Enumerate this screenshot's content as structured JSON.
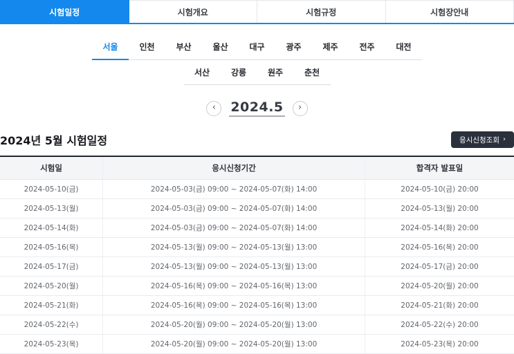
{
  "tabs": [
    {
      "label": "시험일정",
      "active": true
    },
    {
      "label": "시험개요",
      "active": false
    },
    {
      "label": "시험규정",
      "active": false
    },
    {
      "label": "시험장안내",
      "active": false
    }
  ],
  "city_nav": {
    "row1": [
      {
        "label": "서울",
        "active": true
      },
      {
        "label": "인천",
        "active": false
      },
      {
        "label": "부산",
        "active": false
      },
      {
        "label": "울산",
        "active": false
      },
      {
        "label": "대구",
        "active": false
      },
      {
        "label": "광주",
        "active": false
      },
      {
        "label": "제주",
        "active": false
      },
      {
        "label": "전주",
        "active": false
      },
      {
        "label": "대전",
        "active": false
      }
    ],
    "row2": [
      {
        "label": "서산",
        "active": false
      },
      {
        "label": "강릉",
        "active": false
      },
      {
        "label": "원주",
        "active": false
      },
      {
        "label": "춘천",
        "active": false
      }
    ]
  },
  "pager": {
    "prev_icon": "‹",
    "label": "2024.5",
    "next_icon": "›"
  },
  "section": {
    "title": "2024년 5월 시험일정",
    "apply_button_label": "응시신청조회",
    "apply_button_arrow": "›"
  },
  "schedule_table": {
    "headers": [
      "시험일",
      "응시신청기간",
      "합격자 발표일"
    ],
    "rows": [
      [
        "2024-05-10(금)",
        "2024-05-03(금) 09:00 ~ 2024-05-07(화) 14:00",
        "2024-05-10(금) 20:00"
      ],
      [
        "2024-05-13(월)",
        "2024-05-03(금) 09:00 ~ 2024-05-07(화) 14:00",
        "2024-05-13(월) 20:00"
      ],
      [
        "2024-05-14(화)",
        "2024-05-03(금) 09:00 ~ 2024-05-07(화) 14:00",
        "2024-05-14(화) 20:00"
      ],
      [
        "2024-05-16(목)",
        "2024-05-13(월) 09:00 ~ 2024-05-13(월) 13:00",
        "2024-05-16(목) 20:00"
      ],
      [
        "2024-05-17(금)",
        "2024-05-13(월) 09:00 ~ 2024-05-13(월) 13:00",
        "2024-05-17(금) 20:00"
      ],
      [
        "2024-05-20(월)",
        "2024-05-16(목) 09:00 ~ 2024-05-16(목) 13:00",
        "2024-05-20(월) 20:00"
      ],
      [
        "2024-05-21(화)",
        "2024-05-16(목) 09:00 ~ 2024-05-16(목) 13:00",
        "2024-05-21(화) 20:00"
      ],
      [
        "2024-05-22(수)",
        "2024-05-20(월) 09:00 ~ 2024-05-20(월) 13:00",
        "2024-05-22(수) 20:00"
      ],
      [
        "2024-05-23(목)",
        "2024-05-20(월) 09:00 ~ 2024-05-20(월) 13:00",
        "2024-05-23(목) 20:00"
      ]
    ]
  },
  "colors": {
    "accent_blue": "#1488ec",
    "button_dark": "#2a303c",
    "table_header_bg": "#f4f5f7",
    "table_top_border": "#22252b"
  }
}
